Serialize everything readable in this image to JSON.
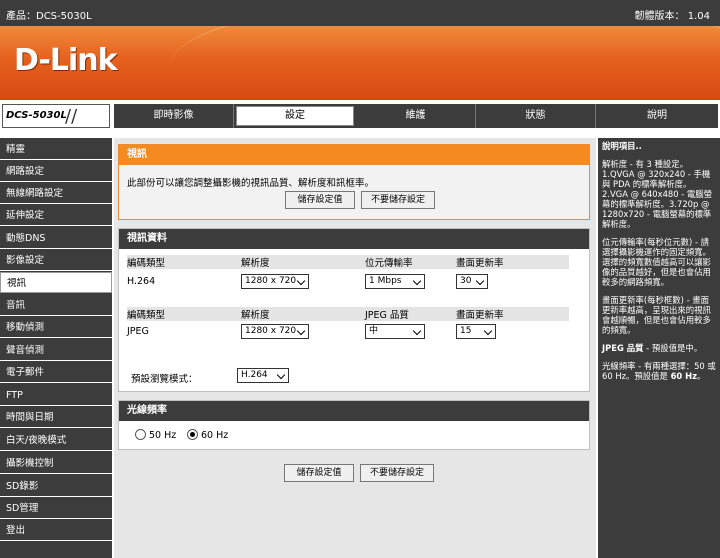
{
  "topbar": {
    "product": "產品：DCS-5030L",
    "firmware": "韌體版本： 1.04"
  },
  "banner": {
    "logo": "D-Link"
  },
  "model": {
    "name": "DCS-5030L"
  },
  "tabs": [
    "即時影像",
    "設定",
    "維護",
    "狀態",
    "說明"
  ],
  "sidebar": {
    "items": [
      "精靈",
      "網路設定",
      "無線網路設定",
      "延伸設定",
      "動態DNS",
      "影像設定",
      "視訊",
      "音訊",
      "移動偵測",
      "聲音偵測",
      "電子郵件",
      "FTP",
      "時間與日期",
      "白天/夜晚模式",
      "攝影機控制",
      "SD錄影",
      "SD管理",
      "登出"
    ],
    "active": "視訊"
  },
  "video": {
    "title": "視訊",
    "desc": "此部份可以讓您調整攝影機的視訊品質、解析度和訊框率。",
    "save": "儲存設定值",
    "nosave": "不要儲存設定"
  },
  "profile": {
    "title": "視訊資料",
    "h264": {
      "h_codec": "編碼類型",
      "h_res": "解析度",
      "h_bitrate": "位元傳輸率",
      "h_fps": "畫面更新率",
      "codec": "H.264",
      "res": "1280 x 720",
      "bitrate": "1 Mbps",
      "fps": "30"
    },
    "jpeg": {
      "h_codec": "編碼類型",
      "h_res": "解析度",
      "h_quality": "JPEG 品質",
      "h_fps": "畫面更新率",
      "codec": "JPEG",
      "res": "1280 x 720",
      "quality": "中",
      "fps": "15"
    },
    "preview_label": "預設瀏覽模式：",
    "preview": "H.264"
  },
  "freq": {
    "title": "光線頻率",
    "opt50": "50 Hz",
    "opt60": "60 Hz",
    "selected": "60 Hz"
  },
  "bottom": {
    "save": "儲存設定值",
    "nosave": "不要儲存設定"
  },
  "help": {
    "title": "說明項目..",
    "p1": "解析度 - 有 3 種設定。1.QVGA @ 320x240 - 手機與 PDA 的標準解析度。2.VGA @ 640x480 - 電腦螢幕的標準解析度。3.720p @ 1280x720 - 電腦螢幕的標準解析度。",
    "p2": "位元傳輸率(每秒位元數) - 請選擇攝影機運作的固定頻寬。選擇的頻寬數值越高可以讓影像的品質越好，但是也會佔用較多的網路頻寬。",
    "p3": "畫面更新率(每秒框數) - 畫面更新率越高，呈現出來的視訊會越順暢，但是也會佔用較多的頻寬。",
    "p4_b": "JPEG 品質",
    "p4": " - 預設值是中。",
    "p5": "光線頻率 - 有兩種選擇：50 或 60 Hz。預設值是 ",
    "p5_b": "60 Hz",
    "p5_end": "。"
  }
}
